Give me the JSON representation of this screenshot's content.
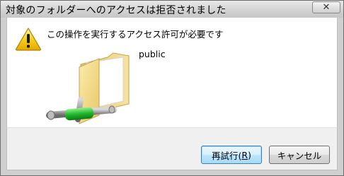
{
  "window": {
    "title": "対象のフォルダーへのアクセスは拒否されました",
    "close_glyph": "✕"
  },
  "content": {
    "message": "この操作を実行するアクセス許可が必要です",
    "folder_name": "public",
    "icons": [
      "warning-icon",
      "network-folder-icon"
    ]
  },
  "buttons": {
    "retry_prefix": "再試行(",
    "retry_mnemonic": "R",
    "retry_suffix": ")",
    "cancel": "キャンセル"
  }
}
